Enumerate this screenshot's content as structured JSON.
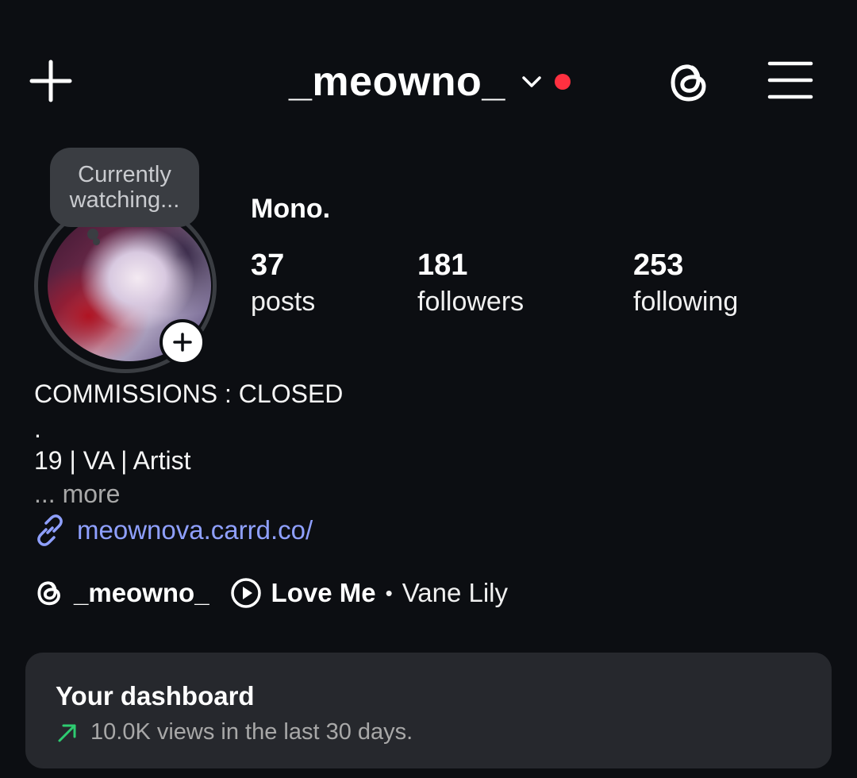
{
  "header": {
    "username": "_meowno_",
    "icons": {
      "create": "plus-icon",
      "account_switch": "chevron-down-icon",
      "notification": "red-dot",
      "threads": "threads-icon",
      "menu": "hamburger-menu-icon"
    },
    "notification_color": "#ff3040"
  },
  "profile": {
    "note": "Currently watching...",
    "display_name": "Mono.",
    "stats": [
      {
        "value": "37",
        "label": "posts"
      },
      {
        "value": "181",
        "label": "followers"
      },
      {
        "value": "253",
        "label": "following"
      }
    ]
  },
  "bio": {
    "line1": "COMMISSIONS : CLOSED",
    "line2": ".",
    "line3": "19 | VA | Artist",
    "more": "... more",
    "link": "meownova.carrd.co/",
    "link_color": "#8fa0ff"
  },
  "chips": {
    "threads_handle": "_meowno_",
    "song_title": "Love Me",
    "separator": "•",
    "song_artist": "Vane Lily"
  },
  "dashboard": {
    "title": "Your dashboard",
    "subtitle": "10.0K views in the last 30 days.",
    "trend_color": "#2ecc71"
  }
}
